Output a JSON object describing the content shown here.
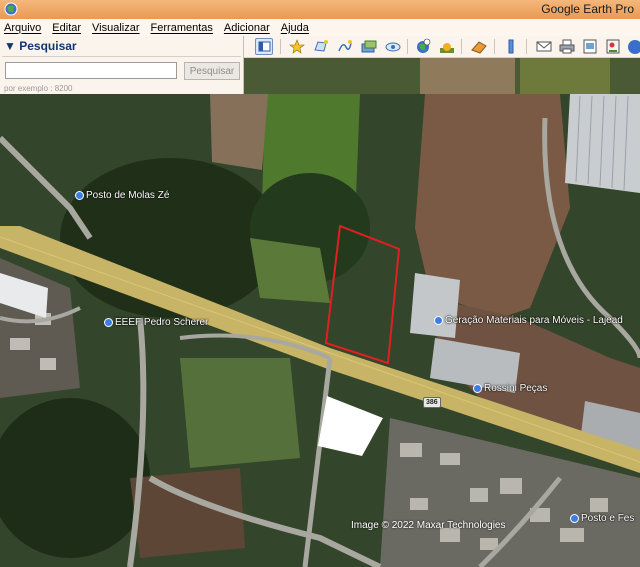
{
  "window": {
    "title": "Google Earth Pro"
  },
  "menu": [
    "Arquivo",
    "Editar",
    "Visualizar",
    "Ferramentas",
    "Adicionar",
    "Ajuda"
  ],
  "search_panel": {
    "header": "Pesquisar",
    "input_value": "",
    "button_label": "Pesquisar",
    "hint": "por exemplo : 8200"
  },
  "toolbar_icons": [
    "sidebar-toggle-icon",
    "placemark-icon",
    "polygon-icon",
    "path-icon",
    "overlay-icon",
    "tour-icon",
    "historical-imagery-icon",
    "sunlight-icon",
    "planets-icon",
    "ruler-icon",
    "email-icon",
    "print-icon",
    "save-image-icon",
    "maps-icon",
    "globe-icon"
  ],
  "map": {
    "labels": {
      "posto_molas": "Posto de Molas Zé",
      "eeef": "EEEF Pedro Scherer",
      "geracao": "Geração Materiais para Móveis - Lajead",
      "rossini": "Rossini Peças",
      "posto_fes": "Posto e Fes"
    },
    "road_number": "386",
    "attribution": "Image © 2022 Maxar Technologies",
    "boundary_color": "#e02020"
  }
}
